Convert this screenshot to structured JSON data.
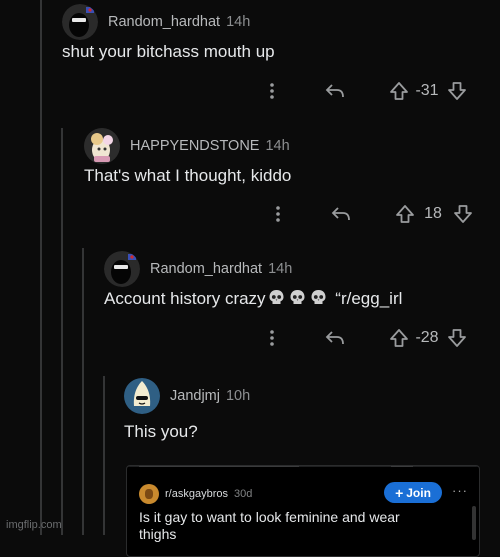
{
  "comments": [
    {
      "username": "Random_hardhat",
      "time": "14h",
      "body": "shut your bitchass mouth up",
      "score": "-31"
    },
    {
      "username": "HAPPYENDSTONE",
      "time": "14h",
      "body": "That's what I thought, kiddo",
      "score": "18"
    },
    {
      "username": "Random_hardhat",
      "time": "14h",
      "body_prefix": "Account history crazy",
      "body_suffix": "“r/egg_irl",
      "score": "-28"
    },
    {
      "username": "Jandjmj",
      "time": "10h",
      "body": "This you?"
    }
  ],
  "embed": {
    "subreddit": "r/askgaybros",
    "time": "30d",
    "join_label": "Join",
    "more": "···",
    "title": "Is it gay to want to look feminine and wear thighs"
  },
  "watermark": "imgflip.com",
  "colors": {
    "accent": "#1a6fd6",
    "background": "#0b0b0b",
    "thread_line": "#343536"
  }
}
